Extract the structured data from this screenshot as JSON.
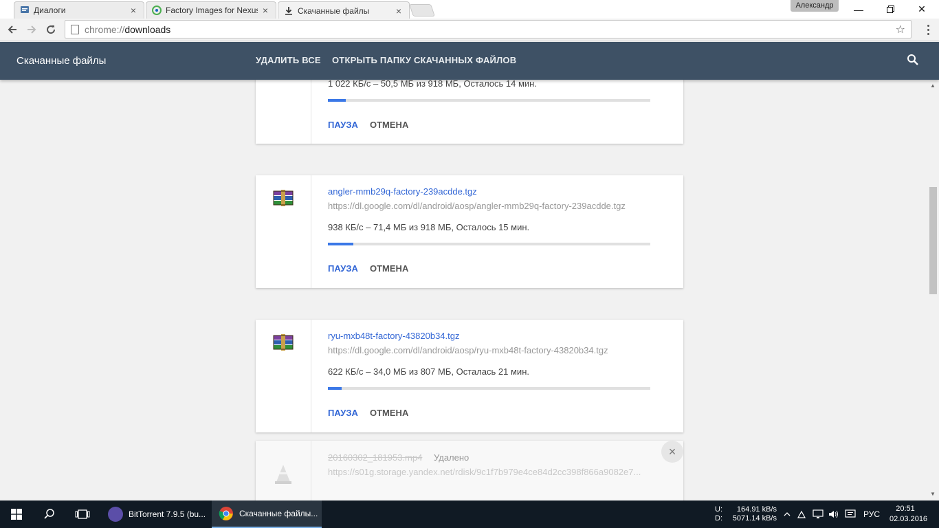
{
  "tabs": [
    {
      "label": "Диалоги",
      "icon": "chat-icon"
    },
    {
      "label": "Factory Images for Nexus",
      "icon": "android-icon"
    },
    {
      "label": "Скачанные файлы",
      "icon": "download-icon"
    }
  ],
  "profile_name": "Александр",
  "address": {
    "scheme": "chrome://",
    "host": "downloads"
  },
  "header": {
    "title": "Скачанные файлы",
    "clear_all": "УДАЛИТЬ ВСЕ",
    "open_folder": "ОТКРЫТЬ ПАПКУ СКАЧАННЫХ ФАЙЛОВ"
  },
  "downloads": [
    {
      "status": "1 022 КБ/с – 50,5 МБ из 918 МБ, Осталось 14 мин.",
      "progress": 0.055,
      "pause": "ПАУЗА",
      "cancel": "ОТМЕНА"
    },
    {
      "name": "angler-mmb29q-factory-239acdde.tgz",
      "url": "https://dl.google.com/dl/android/aosp/angler-mmb29q-factory-239acdde.tgz",
      "status": "938 КБ/с – 71,4 МБ из 918 МБ, Осталось 15 мин.",
      "progress": 0.078,
      "pause": "ПАУЗА",
      "cancel": "ОТМЕНА",
      "icon": "winrar-archive-icon"
    },
    {
      "name": "ryu-mxb48t-factory-43820b34.tgz",
      "url": "https://dl.google.com/dl/android/aosp/ryu-mxb48t-factory-43820b34.tgz",
      "status": "622 КБ/с – 34,0 МБ из 807 МБ, Осталась 21 мин.",
      "progress": 0.042,
      "pause": "ПАУЗА",
      "cancel": "ОТМЕНА",
      "icon": "winrar-archive-icon"
    },
    {
      "name": "20160302_181953.mp4",
      "removed_tag": "Удалено",
      "url": "https://s01g.storage.yandex.net/rdisk/9c1f7b979e4ce84d2cc398f866a9082e7...",
      "icon": "vlc-cone-icon"
    }
  ],
  "taskbar": {
    "apps": [
      {
        "label": "BitTorrent 7.9.5  (bu...",
        "icon": "bittorrent-icon"
      },
      {
        "label": "Скачанные файлы...",
        "icon": "chrome-icon"
      }
    ],
    "net_up_label": "U:",
    "net_up_value": "164.91 kB/s",
    "net_down_label": "D:",
    "net_down_value": "5071.14 kB/s",
    "language": "РУС",
    "time": "20:51",
    "date": "02.03.2016"
  },
  "colors": {
    "header_bg": "#3e5165",
    "link_blue": "#3367d6",
    "progress_fill": "#3b78e7",
    "taskbar_bg": "#101a24"
  }
}
